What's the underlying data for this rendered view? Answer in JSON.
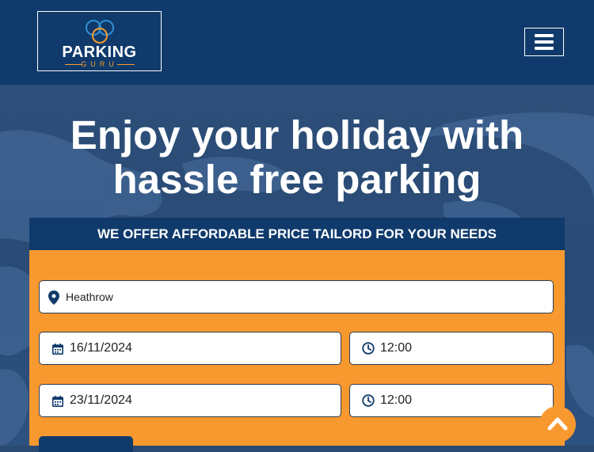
{
  "header": {
    "logo_text": "PARKING",
    "logo_sub": "GURU",
    "menu_icon": "hamburger-icon"
  },
  "hero": {
    "headline_line1": "Enjoy your holiday with",
    "headline_line2": "hassle free parking"
  },
  "booking": {
    "offer_text": "WE OFFER AFFORDABLE PRICE TAILORD FOR YOUR NEEDS",
    "location_value": "Heathrow",
    "location_icon": "map-pin-icon",
    "drop_off_date": "16/11/2024",
    "drop_off_time": "12:00",
    "pick_up_date": "23/11/2024",
    "pick_up_time": "12:00",
    "calendar_icon": "calendar-icon",
    "clock_icon": "clock-icon"
  },
  "scroll_top_icon": "chevron-up-icon",
  "colors": {
    "navy": "#0f3a6b",
    "orange": "#f8992f",
    "logo_blue": "#2e8fd3"
  }
}
